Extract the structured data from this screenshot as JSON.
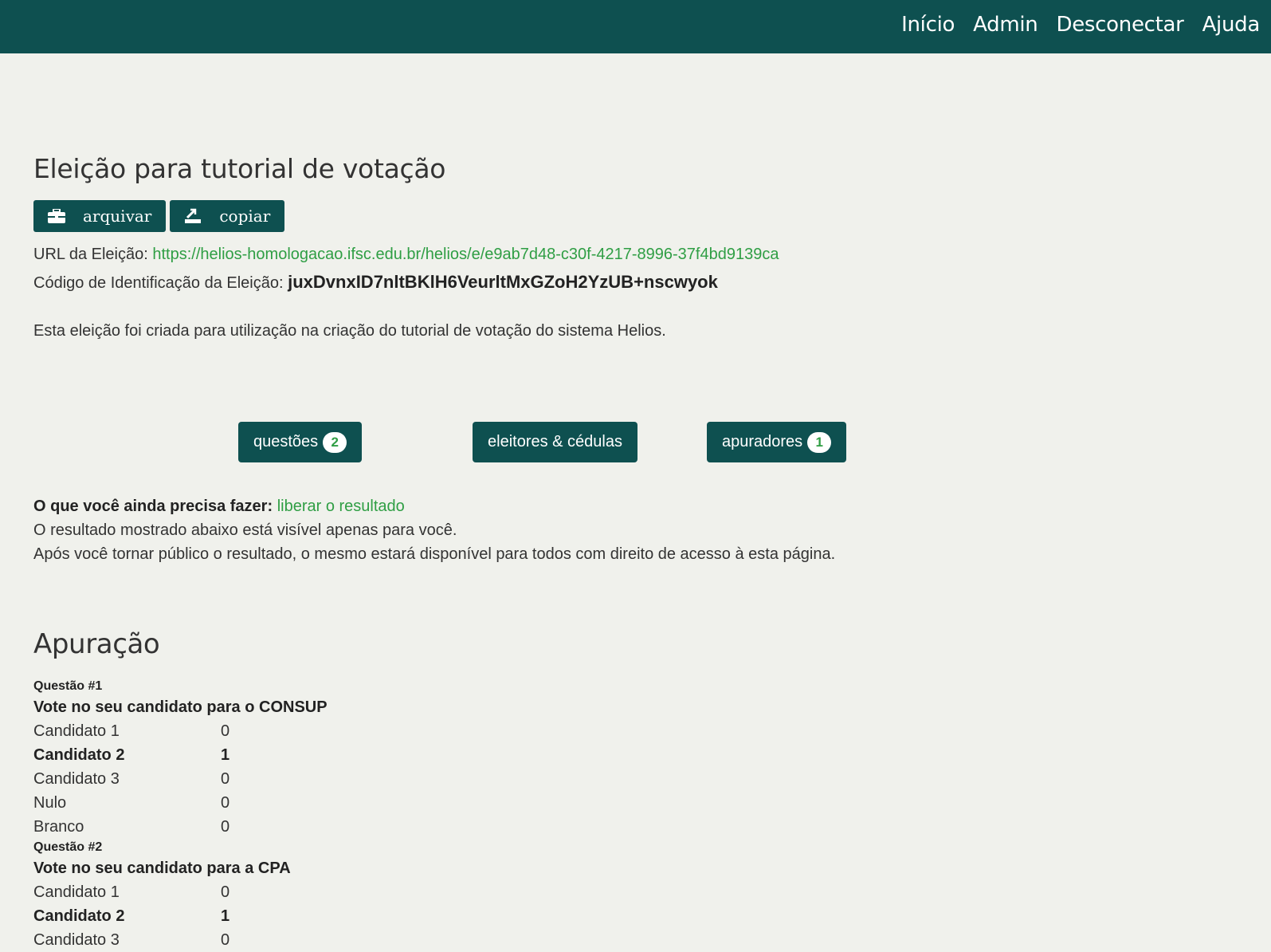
{
  "nav": {
    "items": [
      "Início",
      "Admin",
      "Desconectar",
      "Ajuda"
    ]
  },
  "election": {
    "title": "Eleição para tutorial de votação",
    "archive_label": "arquivar",
    "copy_label": "copiar",
    "url_label": "URL da Eleição:",
    "url": "https://helios-homologacao.ifsc.edu.br/helios/e/e9ab7d48-c30f-4217-8996-37f4bd9139ca",
    "code_label": "Código de Identificação da Eleição:",
    "code": "juxDvnxID7nltBKlH6VeurltMxGZoH2YzUB+nscwyok",
    "description": "Esta eleição foi criada para utilização na criação do tutorial de votação do sistema Helios."
  },
  "tabs": {
    "questions_label": "questões",
    "questions_count": "2",
    "voters_label": "eleitores & cédulas",
    "trustees_label": "apuradores",
    "trustees_count": "1"
  },
  "todo": {
    "label": "O que você ainda precisa fazer:",
    "link": "liberar o resultado",
    "line1": "O resultado mostrado abaixo está visível apenas para você.",
    "line2": "Após você tornar público o resultado, o mesmo estará disponível para todos com direito de acesso à esta página."
  },
  "tally": {
    "title": "Apuração",
    "questions": [
      {
        "number": "Questão #1",
        "text": "Vote no seu candidato para o CONSUP",
        "answers": [
          {
            "name": "Candidato 1",
            "count": "0",
            "winner": false
          },
          {
            "name": "Candidato 2",
            "count": "1",
            "winner": true
          },
          {
            "name": "Candidato 3",
            "count": "0",
            "winner": false
          },
          {
            "name": "Nulo",
            "count": "0",
            "winner": false
          },
          {
            "name": "Branco",
            "count": "0",
            "winner": false
          }
        ]
      },
      {
        "number": "Questão #2",
        "text": "Vote no seu candidato para a CPA",
        "answers": [
          {
            "name": "Candidato 1",
            "count": "0",
            "winner": false
          },
          {
            "name": "Candidato 2",
            "count": "1",
            "winner": true
          },
          {
            "name": "Candidato 3",
            "count": "0",
            "winner": false
          }
        ]
      }
    ]
  },
  "colors": {
    "brand": "#0e5050",
    "link": "#2f9e44",
    "background": "#f0f1ec"
  }
}
